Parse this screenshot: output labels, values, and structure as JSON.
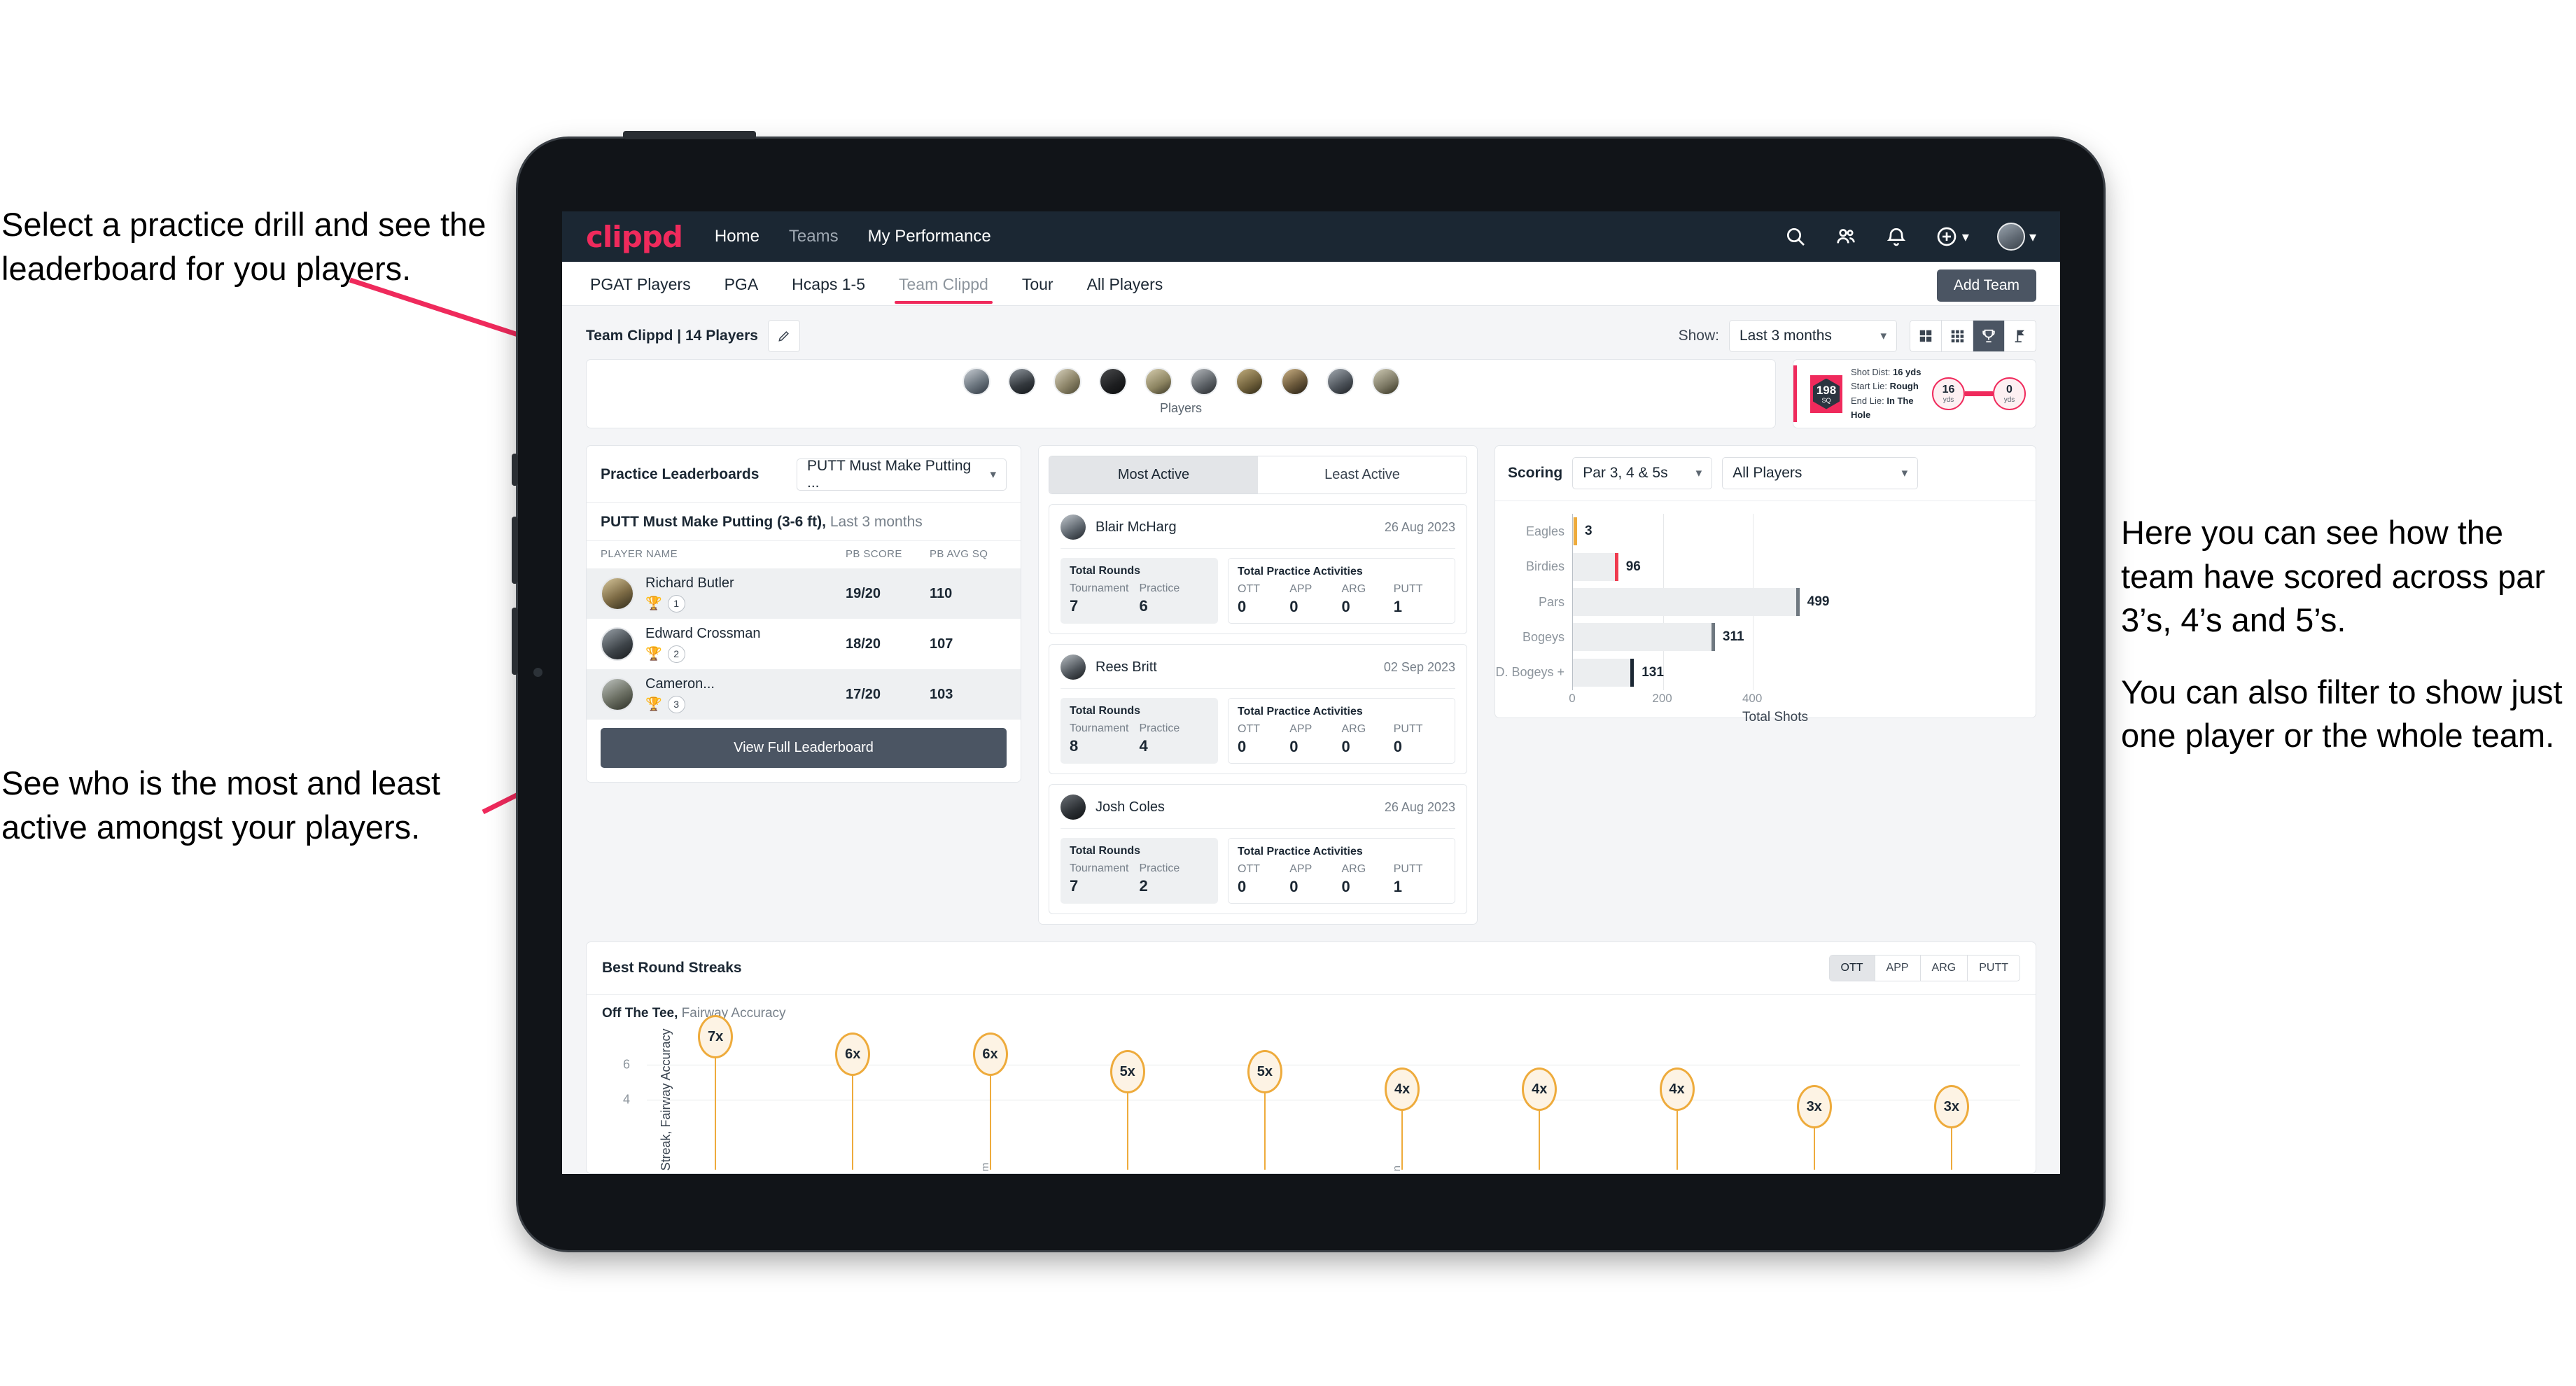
{
  "annotations": {
    "left_top": [
      "Select a practice drill and see the leaderboard for you players."
    ],
    "left_bottom": [
      "See who is the most and least active amongst your players."
    ],
    "right": [
      "Here you can see how the team have scored across par 3’s, 4’s and 5’s.",
      "You can also filter to show just one player or the whole team."
    ]
  },
  "topnav": {
    "logo": "clippd",
    "links": [
      {
        "label": "Home",
        "active": true
      },
      {
        "label": "Teams",
        "active": false
      },
      {
        "label": "My Performance",
        "active": true
      }
    ],
    "icons": [
      "search-icon",
      "people-icon",
      "bell-icon",
      "plus-circle-icon",
      "avatar"
    ]
  },
  "tabs": [
    {
      "label": "PGAT Players",
      "active": false
    },
    {
      "label": "PGA",
      "active": false
    },
    {
      "label": "Hcaps 1-5",
      "active": false
    },
    {
      "label": "Team Clippd",
      "active": true
    },
    {
      "label": "Tour",
      "active": false
    },
    {
      "label": "All Players",
      "active": false
    }
  ],
  "add_team_button": "Add Team",
  "toolbar": {
    "team_title": "Team Clippd | 14 Players",
    "edit_icon": "pencil-icon",
    "show_label": "Show:",
    "show_value": "Last 3 months",
    "view_modes": [
      {
        "name": "grid-2x2-icon",
        "active": false
      },
      {
        "name": "grid-3x3-icon",
        "active": false
      },
      {
        "name": "trophy-icon",
        "active": true
      },
      {
        "name": "golf-flag-icon",
        "active": false
      }
    ]
  },
  "players_strip": {
    "label": "Players",
    "count": 10
  },
  "shot_card": {
    "sq_value": "198",
    "sq_unit": "SQ",
    "lines": [
      {
        "label": "Shot Dist:",
        "value": "16 yds"
      },
      {
        "label": "Start Lie:",
        "value": "Rough"
      },
      {
        "label": "End Lie:",
        "value": "In The Hole"
      }
    ],
    "start": {
      "value": "16",
      "unit": "yds"
    },
    "end": {
      "value": "0",
      "unit": "yds"
    }
  },
  "leaderboard": {
    "title": "Practice Leaderboards",
    "drill_select": "PUTT Must Make Putting ...",
    "subtitle_bold": "PUTT Must Make Putting (3-6 ft),",
    "subtitle_light": "Last 3 months",
    "columns": [
      "PLAYER NAME",
      "PB SCORE",
      "PB AVG SQ"
    ],
    "rows": [
      {
        "name": "Richard Butler",
        "rank": "1",
        "trophy": "gold",
        "pb_score": "19/20",
        "pb_avg_sq": "110"
      },
      {
        "name": "Edward Crossman",
        "rank": "2",
        "trophy": "silver",
        "pb_score": "18/20",
        "pb_avg_sq": "107"
      },
      {
        "name": "Cameron...",
        "rank": "3",
        "trophy": "bronze",
        "pb_score": "17/20",
        "pb_avg_sq": "103"
      }
    ],
    "button": "View Full Leaderboard"
  },
  "activity": {
    "tabs": [
      {
        "label": "Most Active",
        "active": true
      },
      {
        "label": "Least Active",
        "active": false
      }
    ],
    "rounds_title": "Total Rounds",
    "rounds_keys": [
      "Tournament",
      "Practice"
    ],
    "practice_title": "Total Practice Activities",
    "practice_keys": [
      "OTT",
      "APP",
      "ARG",
      "PUTT"
    ],
    "players": [
      {
        "name": "Blair McHarg",
        "date": "26 Aug 2023",
        "rounds": [
          "7",
          "6"
        ],
        "practice": [
          "0",
          "0",
          "0",
          "1"
        ]
      },
      {
        "name": "Rees Britt",
        "date": "02 Sep 2023",
        "rounds": [
          "8",
          "4"
        ],
        "practice": [
          "0",
          "0",
          "0",
          "0"
        ]
      },
      {
        "name": "Josh Coles",
        "date": "26 Aug 2023",
        "rounds": [
          "7",
          "2"
        ],
        "practice": [
          "0",
          "0",
          "0",
          "1"
        ]
      }
    ]
  },
  "scoring": {
    "title": "Scoring",
    "par_select": "Par 3, 4 & 5s",
    "players_select": "All Players"
  },
  "streaks": {
    "title": "Best Round Streaks",
    "segments": [
      {
        "label": "OTT",
        "active": true
      },
      {
        "label": "APP",
        "active": false
      },
      {
        "label": "ARG",
        "active": false
      },
      {
        "label": "PUTT",
        "active": false
      }
    ],
    "sub_bold": "Off The Tee,",
    "sub_light": "Fairway Accuracy"
  },
  "chart_data": [
    {
      "type": "bar",
      "orientation": "horizontal",
      "title": "Scoring",
      "categories": [
        "Eagles",
        "Birdies",
        "Pars",
        "Bogeys",
        "D. Bogeys +"
      ],
      "values": [
        3,
        96,
        499,
        311,
        131
      ],
      "cap_colors": [
        "#eeab3c",
        "#ef3b4f",
        "#6f7880",
        "#6f7880",
        "#1b2733"
      ],
      "xlabel": "Total Shots",
      "ylabel": "",
      "xticks": [
        0,
        200,
        400
      ],
      "xlim": [
        0,
        560
      ],
      "grid": true,
      "legend": "none"
    },
    {
      "type": "bar",
      "variant": "lollipop",
      "title": "Best Round Streaks",
      "subtitle": "Off The Tee, Fairway Accuracy",
      "categories": [
        "",
        "",
        "m",
        "",
        "",
        "n",
        "",
        "",
        "",
        ""
      ],
      "values": [
        7,
        6,
        6,
        5,
        5,
        4,
        4,
        4,
        3,
        3
      ],
      "labels": [
        "7x",
        "6x",
        "6x",
        "5x",
        "5x",
        "4x",
        "4x",
        "4x",
        "3x",
        "3x"
      ],
      "ylabel": "Streak, Fairway Accuracy",
      "yticks": [
        4,
        6
      ],
      "ylim": [
        0,
        8
      ],
      "grid": true,
      "series_color": "#eeab3c"
    }
  ]
}
